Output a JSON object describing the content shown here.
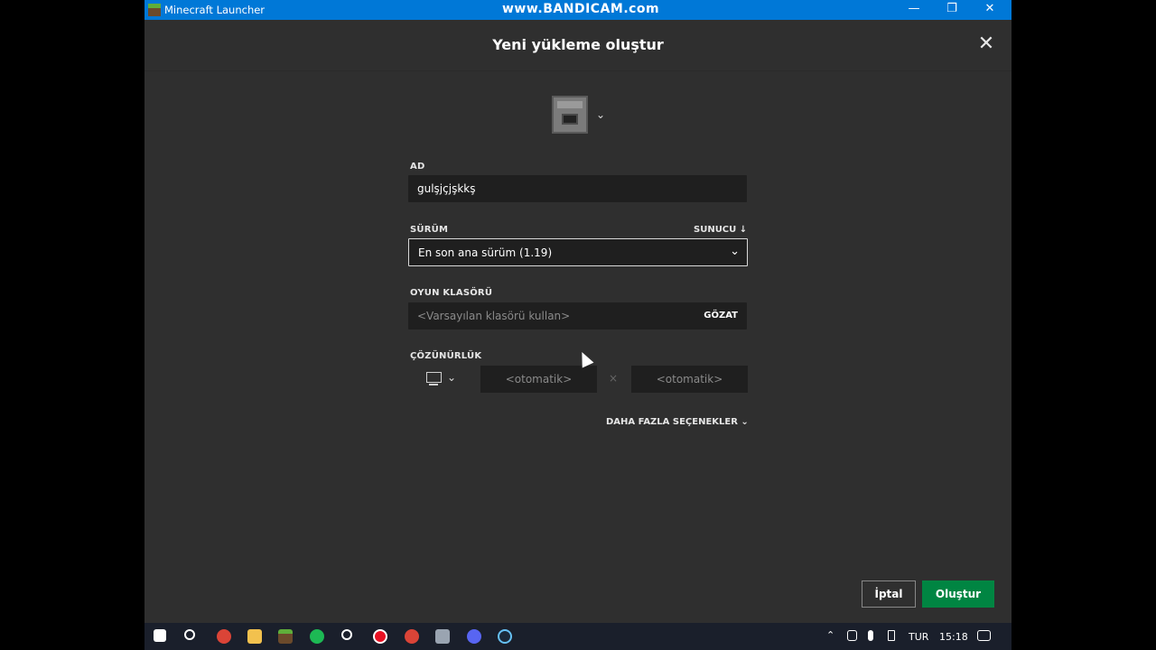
{
  "window": {
    "title": "Minecraft Launcher",
    "watermark": "www.BANDICAM.com",
    "minimize": "—",
    "maximize": "❐",
    "close": "✕"
  },
  "dialog": {
    "title": "Yeni yükleme oluştur",
    "close_icon": "✕",
    "icon_chevron": "⌄"
  },
  "form": {
    "name_label": "AD",
    "name_value": "gulşjçjşkkş",
    "version_label": "SÜRÜM",
    "server_link": "SUNUCU ↓",
    "version_value": "En son ana sürüm (1.19)",
    "version_chevron": "⌄",
    "folder_label": "OYUN KLASÖRÜ",
    "folder_placeholder": "<Varsayılan klasörü kullan>",
    "browse_label": "GÖZAT",
    "resolution_label": "ÇÖZÜNÜRLÜK",
    "resolution_chevron": "⌄",
    "width_placeholder": "<otomatik>",
    "times": "×",
    "height_placeholder": "<otomatik>",
    "more_options": "DAHA FAZLA SEÇENEKLER ⌄"
  },
  "buttons": {
    "cancel": "İptal",
    "create": "Oluştur"
  },
  "taskbar": {
    "language": "TUR",
    "time": "15:18"
  },
  "colors": {
    "accent_green": "#008542",
    "titlebar_blue": "#0078d7"
  }
}
